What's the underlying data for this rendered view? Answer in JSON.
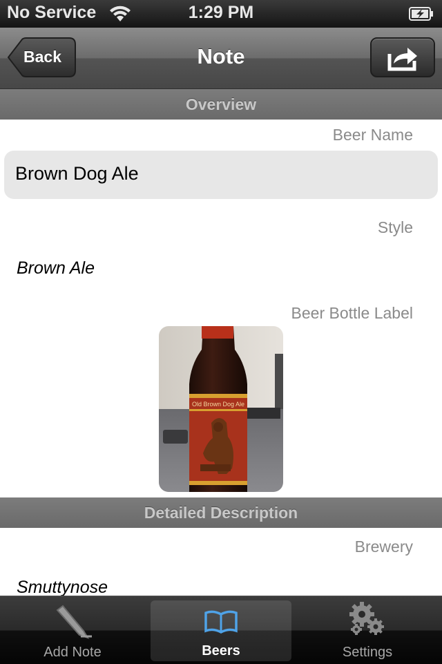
{
  "status_bar": {
    "carrier": "No Service",
    "time": "1:29 PM"
  },
  "nav": {
    "back_label": "Back",
    "title": "Note"
  },
  "sections": {
    "overview": "Overview",
    "detailed": "Detailed Description"
  },
  "fields": {
    "beer_name_label": "Beer Name",
    "beer_name_value": "Brown Dog Ale",
    "style_label": "Style",
    "style_value": "Brown Ale",
    "bottle_label": "Beer Bottle Label",
    "brewery_label": "Brewery",
    "brewery_value": "Smuttynose"
  },
  "bottle_photo": {
    "label_text": "Old Brown Dog Ale"
  },
  "tabs": [
    {
      "label": "Add Note",
      "icon": "pencil-icon",
      "selected": false
    },
    {
      "label": "Beers",
      "icon": "book-icon",
      "selected": true
    },
    {
      "label": "Settings",
      "icon": "gears-icon",
      "selected": false
    }
  ],
  "colors": {
    "tab_selected_icon": "#4fa3e8"
  }
}
